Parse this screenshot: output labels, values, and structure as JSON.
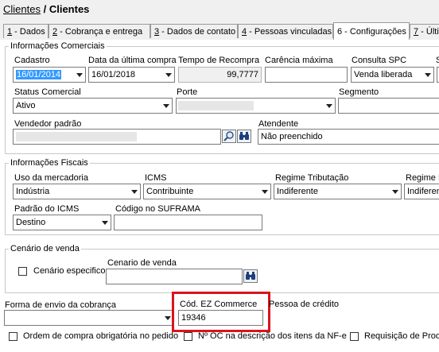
{
  "breadcrumb": {
    "parent": "Clientes",
    "separator": "/",
    "current": "Clientes"
  },
  "tabs": [
    {
      "num": "1",
      "label": " - Dados"
    },
    {
      "num": "2",
      "label": " - Cobrança e entrega"
    },
    {
      "num": "3",
      "label": " - Dados de contato"
    },
    {
      "num": "4",
      "label": " - Pessoas vinculadas"
    },
    {
      "num": "6",
      "label": " - Configurações"
    },
    {
      "num": "7",
      "label": " - Últi"
    }
  ],
  "comerciais": {
    "legend": "Informações Comerciais",
    "cadastro": {
      "label": "Cadastro",
      "value": "16/01/2014"
    },
    "ultima_compra": {
      "label": "Data da última compra",
      "value": "16/01/2018"
    },
    "tempo_recompra": {
      "label": "Tempo de Recompra",
      "value": "99,7777"
    },
    "carencia": {
      "label": "Carência máxima",
      "value": ""
    },
    "spc": {
      "label": "Consulta SPC",
      "value": "Venda liberada"
    },
    "status": {
      "label": "Status Comercial",
      "value": "Ativo"
    },
    "porte": {
      "label": "Porte",
      "value": ""
    },
    "segmento": {
      "label": "Segmento",
      "value": ""
    },
    "vendedor": {
      "label": "Vendedor padrão",
      "value": ""
    },
    "atendente": {
      "label": "Atendente",
      "value": "Não preenchido"
    }
  },
  "fiscais": {
    "legend": "Informações Fiscais",
    "uso": {
      "label": "Uso da mercadoria",
      "value": "Indústria"
    },
    "icms": {
      "label": "ICMS",
      "value": "Contribuinte"
    },
    "regime_trib": {
      "label": "Regime Tributação",
      "value": "Indiferente"
    },
    "regime_e": {
      "label": "Regime E",
      "value": "Indiferen"
    },
    "padrao_icms": {
      "label": "Padrão do ICMS",
      "value": "Destino"
    },
    "suframa": {
      "label": "Código no SUFRAMA",
      "value": ""
    }
  },
  "cenario": {
    "legend": "Cenário de venda",
    "especifico_label": "Cenário especifico",
    "cenario_label": "Cenario de venda",
    "cenario_value": ""
  },
  "bottom": {
    "forma_envio_label": "Forma de envio da cobrança",
    "forma_envio_value": "",
    "ez_label": "Cód. EZ Commerce",
    "ez_value": "19346",
    "pessoa_credito_label": "Pessoa de crédito",
    "chk_ordem": "Ordem de compra obrigatória no pedido",
    "chk_oc": "Nº OC na descrição dos itens da NF-e",
    "chk_req": "Requisição de Prod"
  },
  "colors": {
    "highlight": "#d9141c",
    "selection": "#3399ff"
  }
}
